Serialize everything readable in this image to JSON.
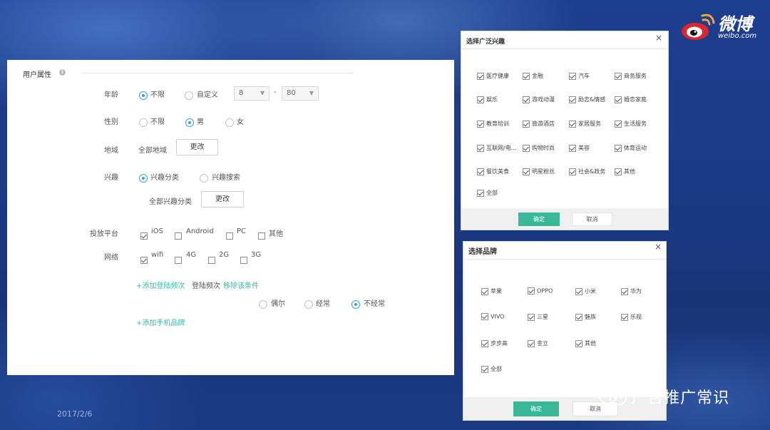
{
  "weibo": {
    "name": "微博",
    "domain": "weibo.com"
  },
  "date": "2017/2/6",
  "watermark": "广告推广常识",
  "main_panel": {
    "section_title": "用户属性",
    "age": {
      "label": "年龄",
      "opt_unlimited": "不限",
      "opt_custom": "自定义",
      "min": "8",
      "dash": "-",
      "max": "80"
    },
    "gender": {
      "label": "性别",
      "opt_unlimited": "不限",
      "opt_male": "男",
      "opt_female": "女"
    },
    "region": {
      "label": "地域",
      "value": "全部地域",
      "change": "更改"
    },
    "interest": {
      "label": "兴趣",
      "opt_category": "兴趣分类",
      "opt_search": "兴趣搜索",
      "all_value": "全部兴趣分类",
      "change": "更改"
    },
    "platform": {
      "label": "投放平台",
      "opts": [
        "iOS",
        "Android",
        "PC",
        "其他"
      ]
    },
    "network": {
      "label": "网络",
      "opts": [
        "wifi",
        "4G",
        "2G",
        "3G"
      ]
    },
    "login": {
      "add": "+添加登陆频次",
      "label": "登陆频次",
      "remove": "移除该条件",
      "opt_occasional": "偶尔",
      "opt_often": "经常",
      "opt_rare": "不经常"
    },
    "add_brand": "+添加手机品牌"
  },
  "interest_dialog": {
    "title": "选择广泛兴趣",
    "close": "×",
    "items": [
      "医疗健康",
      "金融",
      "汽车",
      "商务服务",
      "娱乐",
      "游戏动漫",
      "励志&情感",
      "婚恋家庭",
      "教育培训",
      "旅游酒店",
      "家居服务",
      "生活服务",
      "互联网/电...",
      "购物时尚",
      "美容",
      "体育运动",
      "餐饮美食",
      "明星粉丝",
      "社会&政务",
      "其他",
      "全部"
    ],
    "ok": "确定",
    "cancel": "取消"
  },
  "brand_dialog": {
    "title": "选择品牌",
    "close": "×",
    "items": [
      "苹果",
      "OPPO",
      "小米",
      "华为",
      "VIVO",
      "三星",
      "魅族",
      "乐视",
      "步步高",
      "金立",
      "其他",
      "全部"
    ],
    "ok": "确定",
    "cancel": "取消"
  }
}
